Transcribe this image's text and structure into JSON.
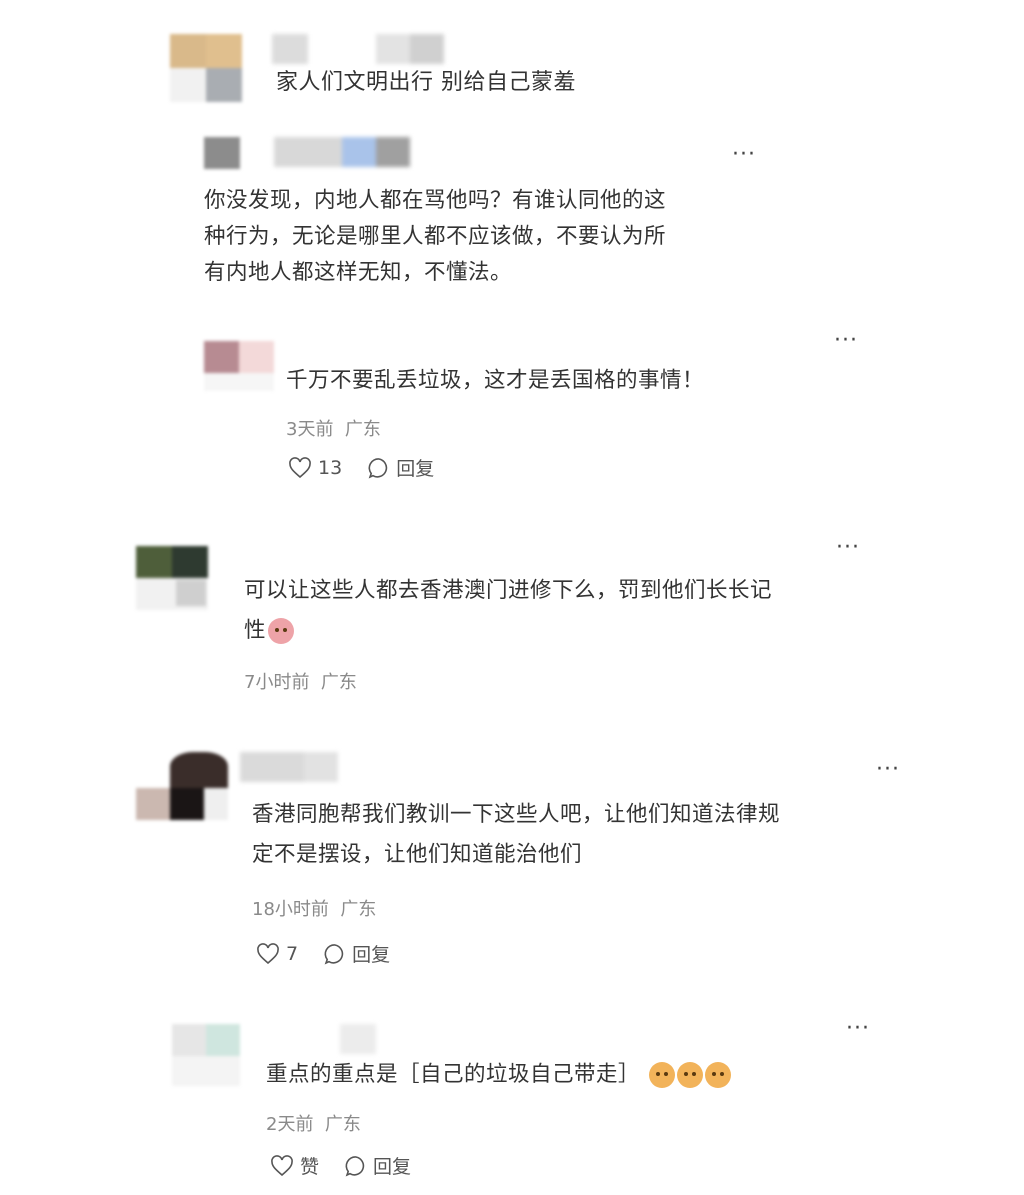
{
  "comments": [
    {
      "text": "家人们文明出行 别给自己蒙羞"
    },
    {
      "text_line1": "你没发现，内地人都在骂他吗？有谁认同他的这",
      "text_line2": "种行为，无论是哪里人都不应该做，不要认为所",
      "text_line3": "有内地人都这样无知，不懂法。"
    },
    {
      "text": "千万不要乱丢垃圾，这才是丢国格的事情！",
      "time": "3天前",
      "location": "广东",
      "likes": "13",
      "reply_label": "回复"
    },
    {
      "text_line1": "可以让这些人都去香港澳门进修下么，罚到他们长长记",
      "text_line2": "性",
      "time": "7小时前",
      "location": "广东"
    },
    {
      "text_line1": "香港同胞帮我们教训一下这些人吧，让他们知道法律规",
      "text_line2": "定不是摆设，让他们知道能治他们",
      "time": "18小时前",
      "location": "广东",
      "likes": "7",
      "reply_label": "回复"
    },
    {
      "text": "重点的重点是［自己的垃圾自己带走］",
      "time": "2天前",
      "location": "广东",
      "likes": "赞",
      "reply_label": "回复"
    }
  ],
  "more_label": "···",
  "icons": [
    "heart-icon",
    "comment-bubble-icon",
    "more-icon",
    "emoji-icon"
  ]
}
